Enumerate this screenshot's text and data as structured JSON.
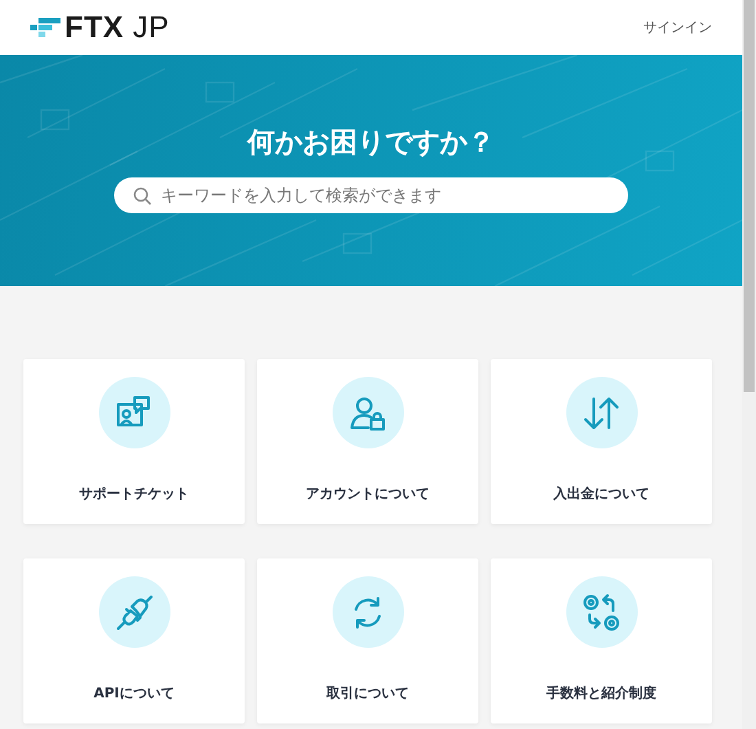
{
  "header": {
    "logo": "**FTX** JP",
    "signin": "サインイン"
  },
  "hero": {
    "title": "何かお困りですか？",
    "search": {
      "placeholder": "キーワードを入力して検索ができます"
    }
  },
  "categories": [
    {
      "kind": "ticket",
      "label": "サポートチケット"
    },
    {
      "kind": "account",
      "label": "アカウントについて"
    },
    {
      "kind": "transfer",
      "label": "入出金について"
    },
    {
      "kind": "api",
      "label": "APIについて"
    },
    {
      "kind": "trade",
      "label": "取引について"
    },
    {
      "kind": "fees",
      "label": "手数料と紹介制度"
    }
  ]
}
